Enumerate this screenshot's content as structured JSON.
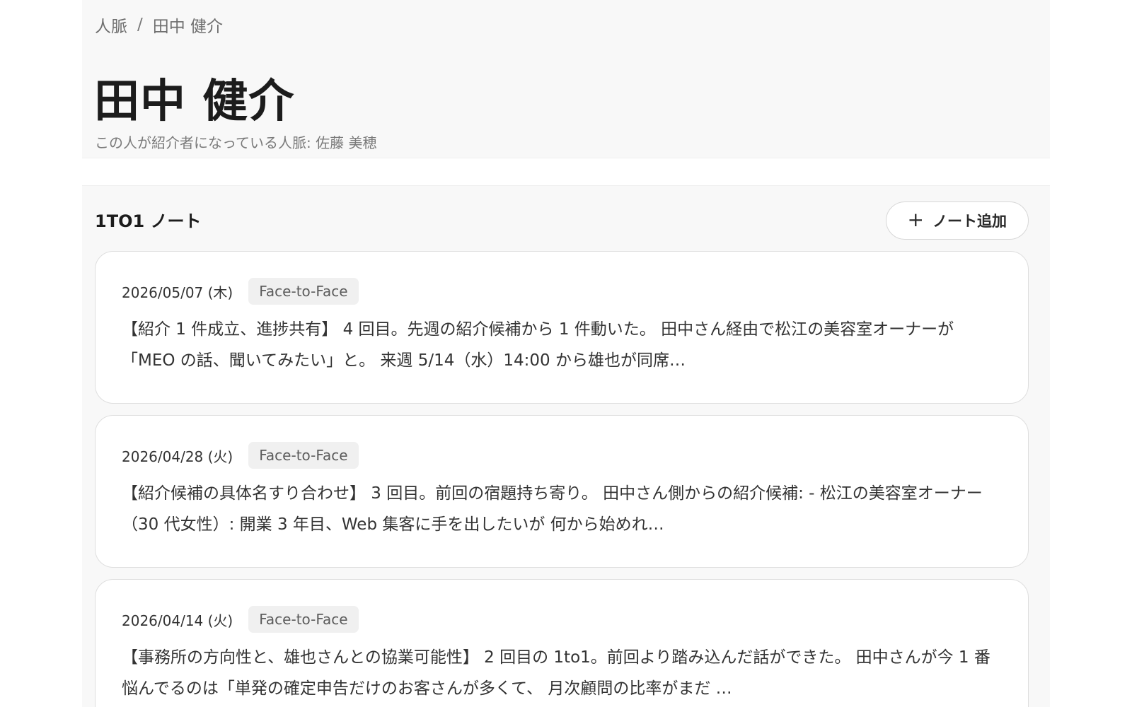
{
  "breadcrumb": {
    "root": "人脈",
    "separator": "/",
    "current": "田中 健介"
  },
  "contact": {
    "name": "田中 健介",
    "introducer_line": "この人が紹介者になっている人脈: 佐藤 美穂"
  },
  "notes_section": {
    "title": "1TO1 ノート",
    "add_button_label": "ノート追加",
    "add_button_icon": "plus-icon",
    "notes": [
      {
        "date": "2026/05/07 (木)",
        "type": "Face-to-Face",
        "snippet": "【紹介 1 件成立、進捗共有】 4 回目。先週の紹介候補から 1 件動いた。 田中さん経由で松江の美容室オーナーが「MEO の話、聞いてみたい」と。 来週 5/14（水）14:00 から雄也が同席…"
      },
      {
        "date": "2026/04/28 (火)",
        "type": "Face-to-Face",
        "snippet": "【紹介候補の具体名すり合わせ】 3 回目。前回の宿題持ち寄り。 田中さん側からの紹介候補: - 松江の美容室オーナー（30 代女性）: 開業 3 年目、Web 集客に手を出したいが 何から始めれ…"
      },
      {
        "date": "2026/04/14 (火)",
        "type": "Face-to-Face",
        "snippet": "【事務所の方向性と、雄也さんとの協業可能性】 2 回目の 1to1。前回より踏み込んだ話ができた。 田中さんが今 1 番悩んでるのは「単発の確定申告だけのお客さんが多くて、 月次顧問の比率がまだ …"
      }
    ]
  }
}
